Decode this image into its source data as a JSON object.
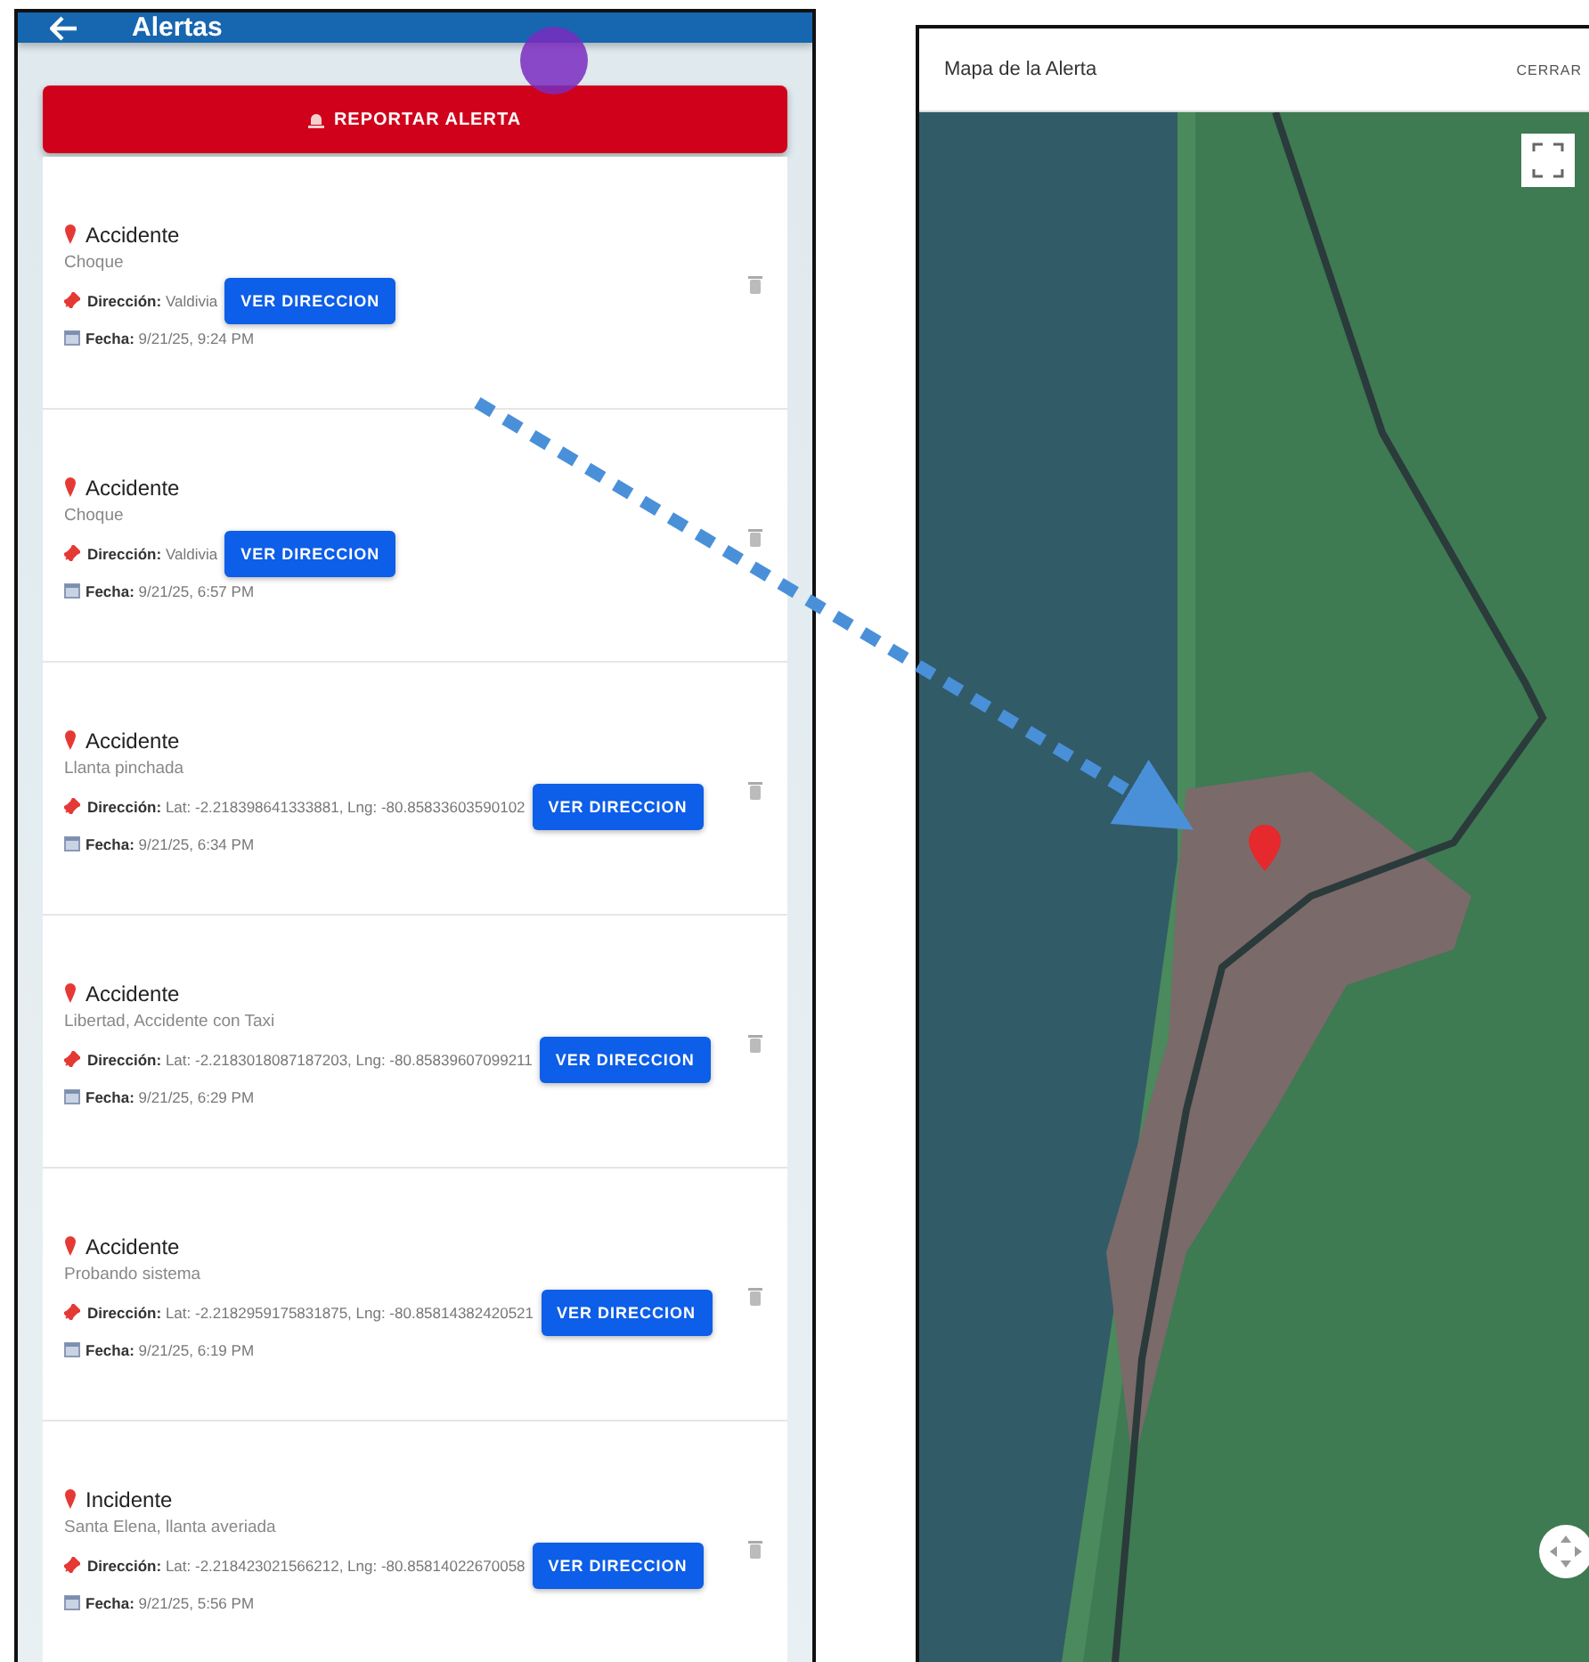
{
  "app_bar": {
    "title": "Alertas"
  },
  "report_button": {
    "label": "REPORTAR ALERTA"
  },
  "alerts": [
    {
      "type": "Accidente",
      "description": "Choque",
      "address_label": "Dirección:",
      "address": "Valdivia",
      "button": "VER DIRECCION",
      "date_label": "Fecha:",
      "date": "9/21/25, 9:24 PM"
    },
    {
      "type": "Accidente",
      "description": "Choque",
      "address_label": "Dirección:",
      "address": "Valdivia",
      "button": "VER DIRECCION",
      "date_label": "Fecha:",
      "date": "9/21/25, 6:57 PM"
    },
    {
      "type": "Accidente",
      "description": "Llanta pinchada",
      "address_label": "Dirección:",
      "address": "Lat: -2.218398641333881, Lng: -80.85833603590102",
      "button": "VER DIRECCION",
      "date_label": "Fecha:",
      "date": "9/21/25, 6:34 PM"
    },
    {
      "type": "Accidente",
      "description": "Libertad, Accidente con Taxi",
      "address_label": "Dirección:",
      "address": "Lat: -2.2183018087187203, Lng: -80.85839607099211",
      "button": "VER DIRECCION",
      "date_label": "Fecha:",
      "date": "9/21/25, 6:29 PM"
    },
    {
      "type": "Accidente",
      "description": "Probando sistema",
      "address_label": "Dirección:",
      "address": "Lat: -2.2182959175831875, Lng: -80.85814382420521",
      "button": "VER DIRECCION",
      "date_label": "Fecha:",
      "date": "9/21/25, 6:19 PM"
    },
    {
      "type": "Incidente",
      "description": "Santa Elena, llanta averiada",
      "address_label": "Dirección:",
      "address": "Lat: -2.218423021566212, Lng: -80.85814022670058",
      "button": "VER DIRECCION",
      "date_label": "Fecha:",
      "date": "9/21/25, 5:56 PM"
    }
  ],
  "map_dialog": {
    "title": "Mapa de la Alerta",
    "close": "CERRAR"
  }
}
